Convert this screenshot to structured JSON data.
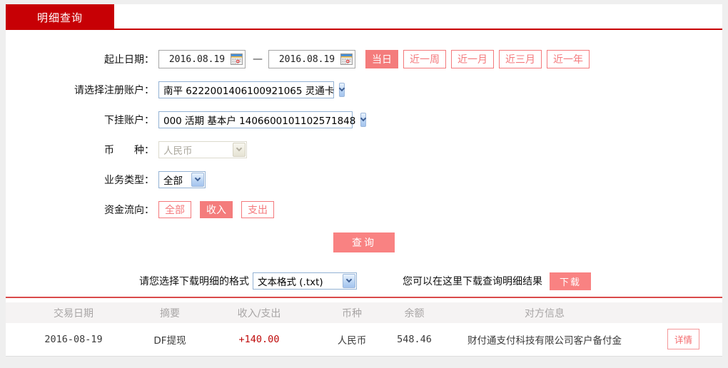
{
  "page": {
    "tab_label": "明细查询"
  },
  "form": {
    "date_range": {
      "label": "起止日期：",
      "start": "2016.08.19",
      "end": "2016.08.19",
      "separator": "—",
      "quick_buttons": [
        {
          "label": "当日",
          "active": true
        },
        {
          "label": "近一周",
          "active": false
        },
        {
          "label": "近一月",
          "active": false
        },
        {
          "label": "近三月",
          "active": false
        },
        {
          "label": "近一年",
          "active": false
        }
      ]
    },
    "register_account": {
      "label": "请选择注册账户：",
      "value": "南平 6222001406100921065 灵通卡"
    },
    "linked_account": {
      "label": "下挂账户：",
      "value": "000 活期 基本户 1406600101102571848"
    },
    "currency": {
      "label": "币　　种：",
      "value": "人民币",
      "disabled": true
    },
    "business_type": {
      "label": "业务类型：",
      "value": "全部"
    },
    "fund_flow": {
      "label": "资金流向：",
      "options": [
        {
          "label": "全部",
          "active": false
        },
        {
          "label": "收入",
          "active": true
        },
        {
          "label": "支出",
          "active": false
        }
      ]
    },
    "query_button_label": "查询"
  },
  "download": {
    "format_label": "请您选择下载明细的格式",
    "format_value": "文本格式 (.txt)",
    "hint": "您可以在这里下载查询明细结果",
    "button_label": "下载"
  },
  "table": {
    "headers": [
      "交易日期",
      "摘要",
      "收入/支出",
      "币种",
      "余额",
      "对方信息",
      ""
    ],
    "rows": [
      {
        "date": "2016-08-19",
        "summary": "DF提现",
        "amount": "+140.00",
        "currency": "人民币",
        "balance": "548.46",
        "counterparty": "财付通支付科技有限公司客户备付金",
        "action_label": "详情"
      }
    ]
  },
  "colors": {
    "brand_red": "#c70005",
    "accent_salmon": "#f47c7c",
    "amount_red": "#bf0b0b",
    "divider_red": "#d94a4a"
  }
}
